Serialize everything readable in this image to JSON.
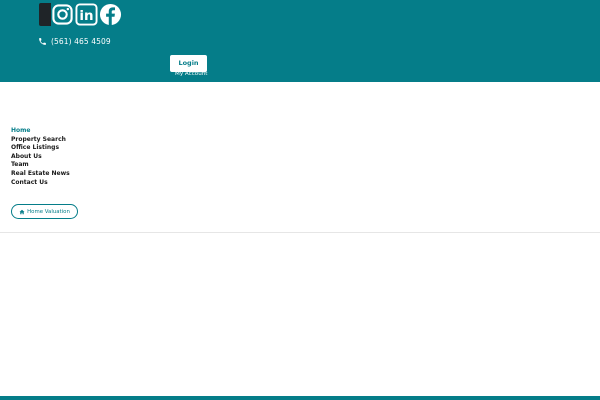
{
  "colors": {
    "brand": "#057d89",
    "white": "#ffffff",
    "dark": "#1f2428",
    "nav_text": "#1a1a1a",
    "divider": "#e6e6e6"
  },
  "social": {
    "icons": [
      "dark-tile",
      "instagram-icon",
      "linkedin-icon",
      "facebook-icon"
    ],
    "linkedin_text": "in"
  },
  "contact": {
    "phone": "(561) 465 4509",
    "icon": "phone-icon"
  },
  "account": {
    "login_label": "Login",
    "my_account_label": "My Account"
  },
  "nav": {
    "items": [
      {
        "label": "Home",
        "active": true
      },
      {
        "label": "Property Search",
        "active": false
      },
      {
        "label": "Office Listings",
        "active": false
      },
      {
        "label": "About Us",
        "active": false
      },
      {
        "label": "Team",
        "active": false
      },
      {
        "label": "Real Estate News",
        "active": false
      },
      {
        "label": "Contact Us",
        "active": false
      }
    ]
  },
  "valuation": {
    "label": "Home Valuation",
    "icon": "home-icon"
  }
}
